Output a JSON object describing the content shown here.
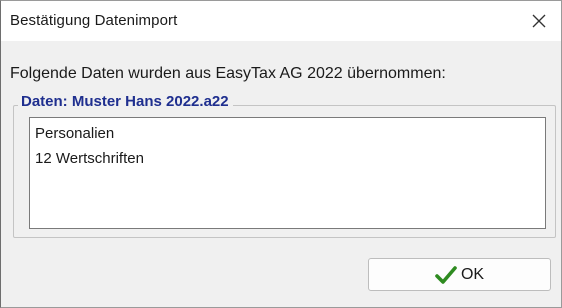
{
  "window": {
    "title": "Bestätigung Datenimport"
  },
  "message": {
    "intro": "Folgende Daten wurden aus EasyTax AG 2022 übernommen:"
  },
  "group": {
    "legend": "Daten: Muster Hans 2022.a22",
    "items": [
      "Personalien",
      "12 Wertschriften"
    ]
  },
  "buttons": {
    "ok_label": "OK",
    "ok_icon": "checkmark-icon"
  },
  "colors": {
    "legend_text": "#1f2f8f",
    "checkmark": "#2e8b20",
    "dialog_background": "#f0f0f0"
  }
}
